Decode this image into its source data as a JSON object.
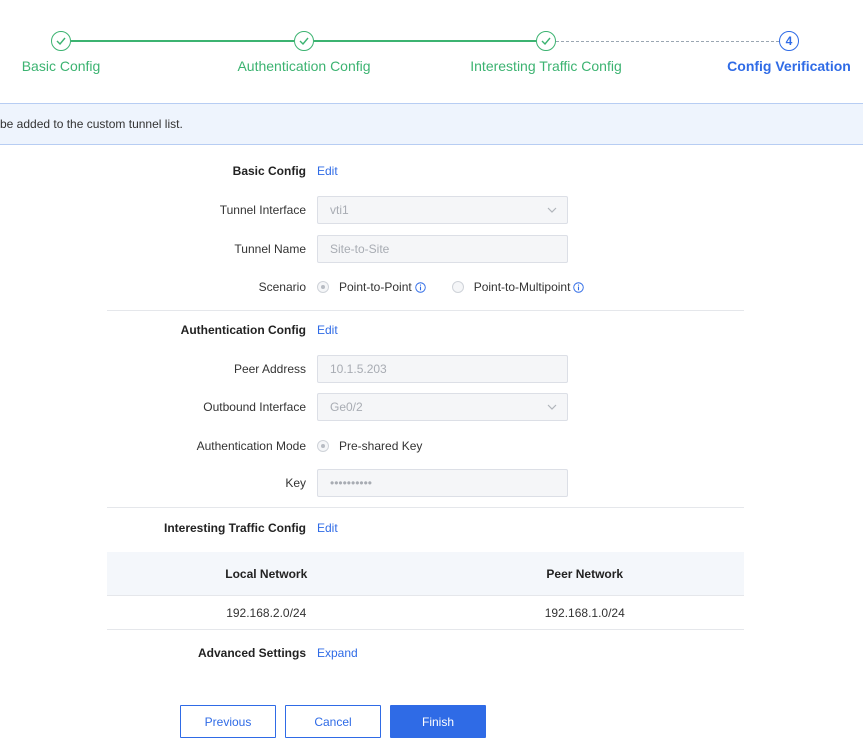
{
  "stepper": {
    "steps": [
      {
        "label": "Basic Config",
        "state": "done"
      },
      {
        "label": "Authentication Config",
        "state": "done"
      },
      {
        "label": "Interesting Traffic Config",
        "state": "done"
      },
      {
        "label": "Config Verification",
        "state": "active",
        "number": "4"
      }
    ]
  },
  "banner": {
    "text": "be added to the custom tunnel list."
  },
  "basic": {
    "section_label": "Basic Config",
    "edit_label": "Edit",
    "tunnel_interface_label": "Tunnel Interface",
    "tunnel_interface_value": "vti1",
    "tunnel_name_label": "Tunnel Name",
    "tunnel_name_value": "Site-to-Site",
    "scenario_label": "Scenario",
    "scenario_options": [
      "Point-to-Point",
      "Point-to-Multipoint"
    ],
    "scenario_selected": "Point-to-Point"
  },
  "auth": {
    "section_label": "Authentication Config",
    "edit_label": "Edit",
    "peer_address_label": "Peer Address",
    "peer_address_value": "10.1.5.203",
    "outbound_interface_label": "Outbound Interface",
    "outbound_interface_value": "Ge0/2",
    "auth_mode_label": "Authentication Mode",
    "auth_mode_value": "Pre-shared Key",
    "key_label": "Key",
    "key_value": "••••••••••"
  },
  "traffic": {
    "section_label": "Interesting Traffic Config",
    "edit_label": "Edit",
    "columns": [
      "Local Network",
      "Peer Network"
    ],
    "rows": [
      [
        "192.168.2.0/24",
        "192.168.1.0/24"
      ]
    ]
  },
  "advanced": {
    "section_label": "Advanced Settings",
    "expand_label": "Expand"
  },
  "buttons": {
    "previous": "Previous",
    "cancel": "Cancel",
    "finish": "Finish"
  },
  "colors": {
    "done": "#3cb371",
    "active": "#2f6be6",
    "banner_bg": "#eef4fd"
  }
}
